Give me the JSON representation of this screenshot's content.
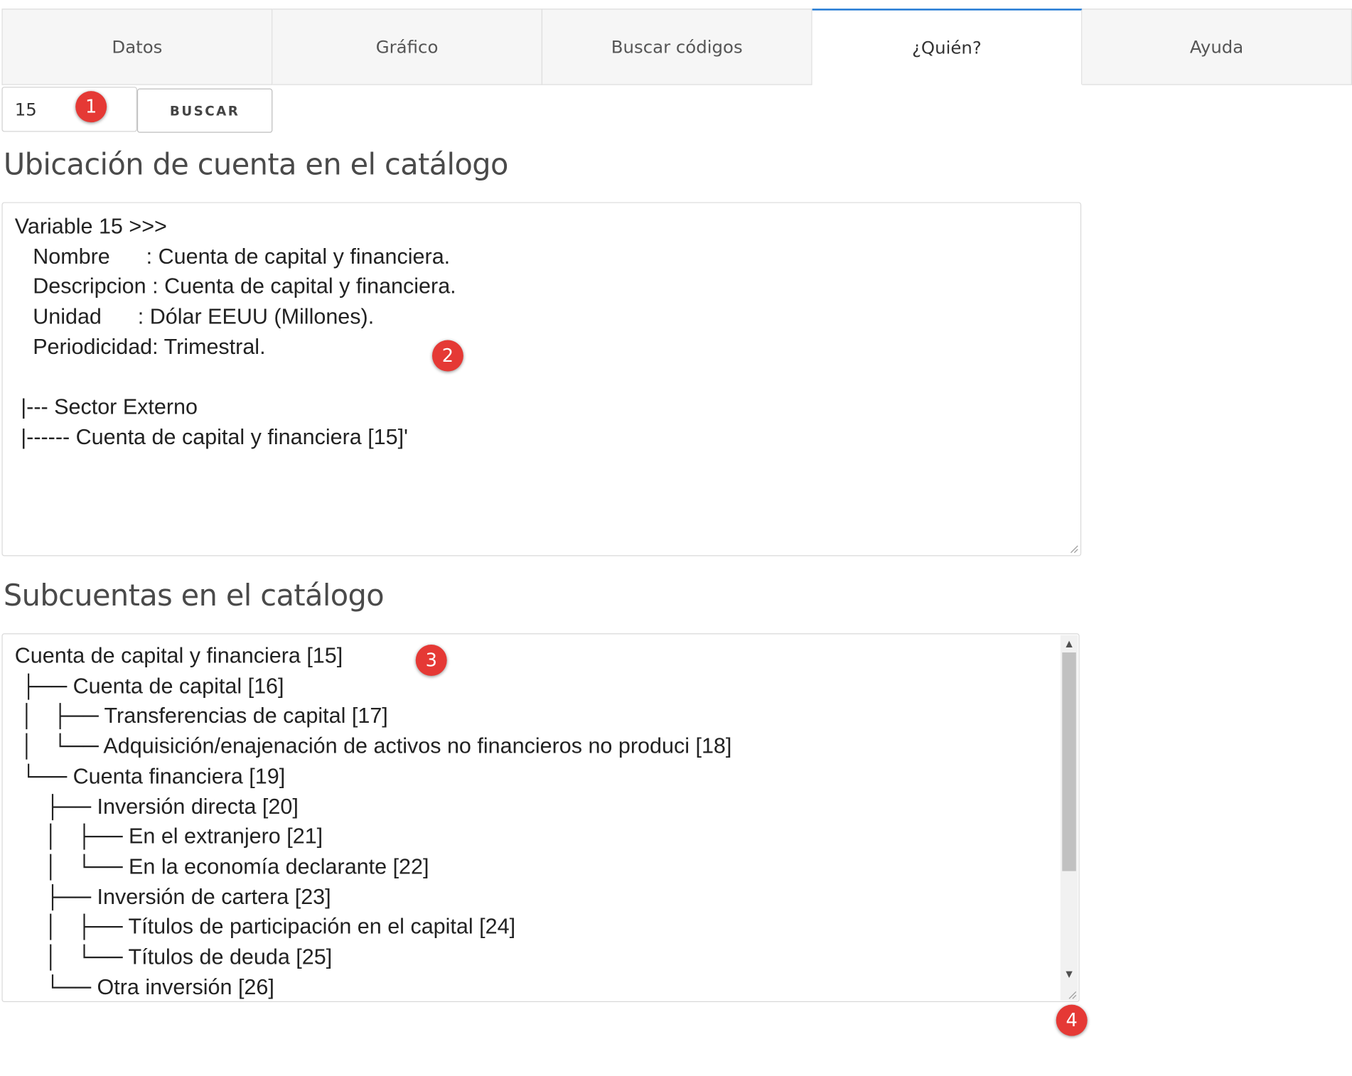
{
  "tabs": [
    {
      "label": "Datos",
      "active": false
    },
    {
      "label": "Gráfico",
      "active": false
    },
    {
      "label": "Buscar códigos",
      "active": false
    },
    {
      "label": "¿Quién?",
      "active": true
    },
    {
      "label": "Ayuda",
      "active": false
    }
  ],
  "search": {
    "value": "15",
    "button_label": "BUSCAR"
  },
  "location": {
    "heading": "Ubicación de cuenta en el catálogo",
    "text": "Variable 15 >>>\n   Nombre      : Cuenta de capital y financiera.\n   Descripcion : Cuenta de capital y financiera.\n   Unidad      : Dólar EEUU (Millones).\n   Periodicidad: Trimestral.\n\n |--- Sector Externo\n |------ Cuenta de capital y financiera [15]'"
  },
  "subaccounts": {
    "heading": "Subcuentas en el catálogo",
    "text": "Cuenta de capital y financiera [15]\n ├── Cuenta de capital [16]\n │   ├── Transferencias de capital [17]\n │   └── Adquisición/enajenación de activos no financieros no produci [18]\n └── Cuenta financiera [19]\n     ├── Inversión directa [20]\n     │   ├── En el extranjero [21]\n     │   └── En la economía declarante [22]\n     ├── Inversión de cartera [23]\n     │   ├── Títulos de participación en el capital [24]\n     │   └── Títulos de deuda [25]\n     └── Otra inversión [26]"
  },
  "markers": [
    "1",
    "2",
    "3",
    "4"
  ],
  "colors": {
    "active_tab_border": "#1e77d3",
    "marker": "#e53935"
  }
}
